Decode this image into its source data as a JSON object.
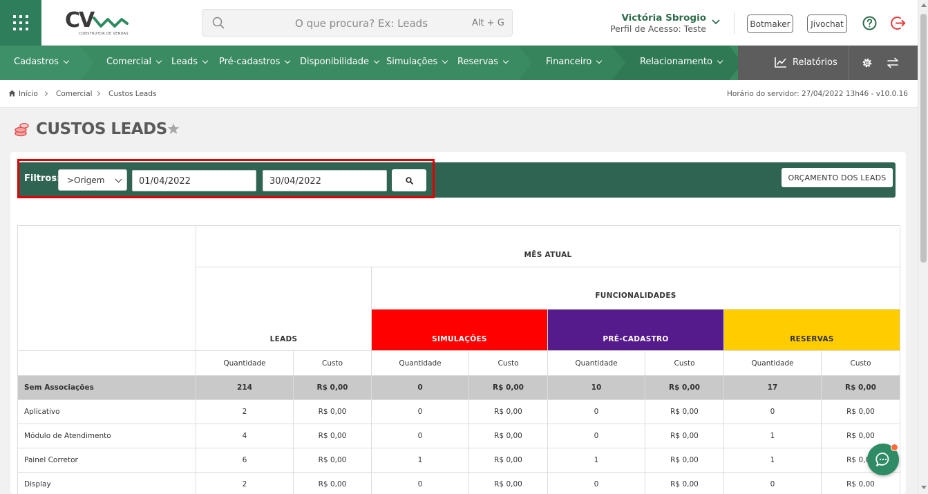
{
  "header": {
    "logo_text": "CV",
    "logo_subtitle": "CONSTRUTOR DE VENDAS",
    "search_placeholder": "O que procura? Ex: Leads",
    "search_shortcut": "Alt + G",
    "user_name": "Victória Sbrogio",
    "user_profile": "Perfil de Acesso: Teste",
    "botmaker_label": "Botmaker",
    "jivochat_label": "Jivochat",
    "brand_color": "#2e7d5b"
  },
  "navbar": {
    "items": [
      "Cadastros",
      "Comercial",
      "Leads",
      "Pré-cadastros",
      "Disponibilidade",
      "Simulações",
      "Reservas",
      "Financeiro",
      "Relacionamento"
    ],
    "reports_label": "Relatórios"
  },
  "breadcrumb": {
    "items": [
      "Início",
      "Comercial",
      "Custos Leads"
    ],
    "server_time": "Horário do servidor: 27/04/2022 13h46 - v10.0.16"
  },
  "page": {
    "title": "CUSTOS LEADS"
  },
  "filters": {
    "label": "Filtros:",
    "origin_value": ">Origem",
    "date_start": "01/04/2022",
    "date_end": "30/04/2022",
    "budget_button": "ORÇAMENTO DOS LEADS"
  },
  "table": {
    "month_header": "MÊS ATUAL",
    "features_header": "FUNCIONALIDADES",
    "groups": [
      {
        "label": "LEADS",
        "color": "#ffffff",
        "text_color": "#333333"
      },
      {
        "label": "SIMULAÇÕES",
        "color": "#ff0000",
        "text_color": "#ffffff"
      },
      {
        "label": "PRÉ-CADASTRO",
        "color": "#551a8b",
        "text_color": "#ffffff"
      },
      {
        "label": "RESERVAS",
        "color": "#ffcc00",
        "text_color": "#333333"
      }
    ],
    "sub_headers": [
      "Quantidade",
      "Custo"
    ],
    "rows": [
      {
        "name": "Sem Associações",
        "highlight": true,
        "values": [
          "214",
          "R$ 0,00",
          "0",
          "R$ 0,00",
          "10",
          "R$ 0,00",
          "17",
          "R$ 0,00"
        ]
      },
      {
        "name": "Aplicativo",
        "highlight": false,
        "values": [
          "2",
          "R$ 0,00",
          "0",
          "R$ 0,00",
          "0",
          "R$ 0,00",
          "0",
          "R$ 0,00"
        ]
      },
      {
        "name": "Módulo de Atendimento",
        "highlight": false,
        "values": [
          "4",
          "R$ 0,00",
          "0",
          "R$ 0,00",
          "0",
          "R$ 0,00",
          "1",
          "R$ 0,00"
        ]
      },
      {
        "name": "Painel Corretor",
        "highlight": false,
        "values": [
          "6",
          "R$ 0,00",
          "1",
          "R$ 0,00",
          "1",
          "R$ 0,00",
          "1",
          "R$ 0,00"
        ]
      },
      {
        "name": "Display",
        "highlight": false,
        "values": [
          "2",
          "R$ 0,00",
          "0",
          "R$ 0,00",
          "0",
          "R$ 0,00",
          "0",
          "R$ 0,00"
        ]
      }
    ]
  }
}
